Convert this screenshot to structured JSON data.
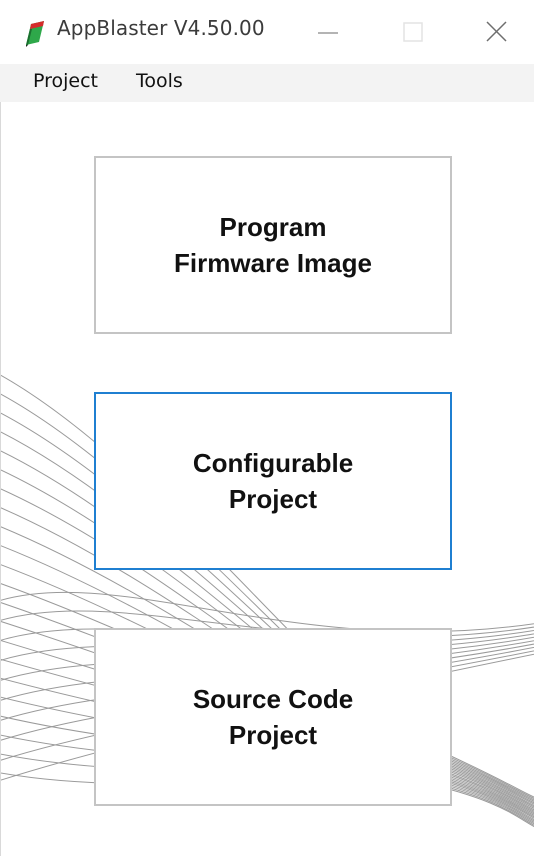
{
  "window": {
    "title": "AppBlaster V4.50.00",
    "icon": "app-icon",
    "controls": [
      "minimize-icon",
      "maximize-icon",
      "close-icon"
    ]
  },
  "menu": {
    "items": [
      {
        "label": "Project"
      },
      {
        "label": "Tools"
      }
    ]
  },
  "buttons": {
    "program_firmware": {
      "line1": "Program",
      "line2": "Firmware Image"
    },
    "configurable": {
      "line1": "Configurable",
      "line2": "Project"
    },
    "source_code": {
      "line1": "Source Code",
      "line2": "Project"
    }
  },
  "colors": {
    "focus_border": "#1f7fd1",
    "button_border": "#c4c4c4",
    "menubar_bg": "#f3f3f3",
    "wave_lines": "#9a9a9a"
  }
}
